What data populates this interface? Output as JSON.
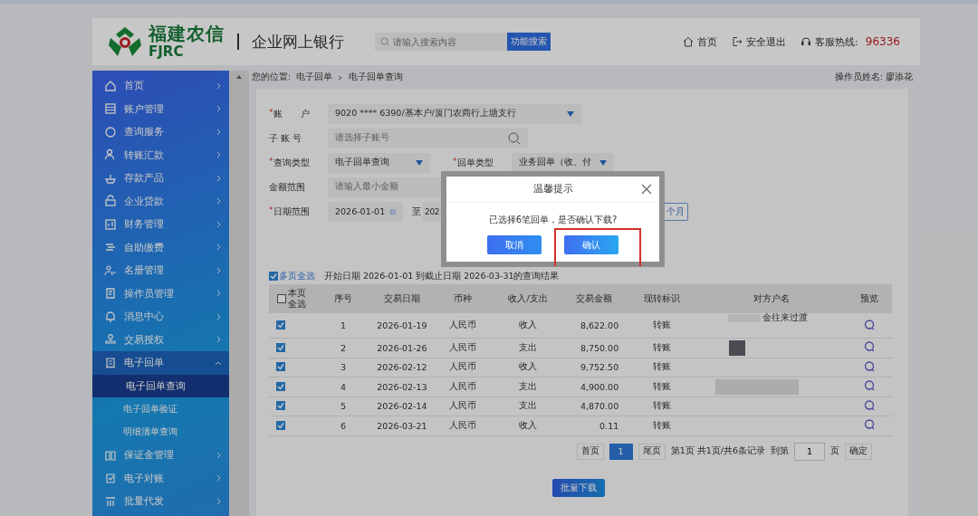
{
  "header": {
    "logo_cn": "福建农信",
    "logo_en": "FJRC",
    "site_title": "企业网上银行",
    "search": {
      "placeholder": "请输入搜索内容"
    },
    "search_button": "功能搜索",
    "links": [
      {
        "kind": "home",
        "label": "首页"
      },
      {
        "kind": "logout",
        "label": "安全退出"
      },
      {
        "kind": "hotline",
        "label": "客服热线:"
      }
    ],
    "hotline_number": "96336"
  },
  "sidebar": {
    "items": [
      {
        "label": "首页",
        "expanded": false
      },
      {
        "label": "账户管理",
        "expanded": false
      },
      {
        "label": "查询服务",
        "expanded": false
      },
      {
        "label": "转账汇款",
        "expanded": false
      },
      {
        "label": "存款产品",
        "expanded": false
      },
      {
        "label": "企业贷款",
        "expanded": false
      },
      {
        "label": "财务管理",
        "expanded": false
      },
      {
        "label": "自助缴费",
        "expanded": false
      },
      {
        "label": "名册管理",
        "expanded": false
      },
      {
        "label": "操作员管理",
        "expanded": false
      },
      {
        "label": "消息中心",
        "expanded": false
      },
      {
        "label": "交易授权",
        "expanded": false
      },
      {
        "label": "电子回单",
        "expanded": true,
        "children": [
          {
            "label": "电子回单查询",
            "selected": true
          },
          {
            "label": "电子回单验证",
            "selected": false
          },
          {
            "label": "明细清单查询",
            "selected": false
          }
        ]
      },
      {
        "label": "保证金管理",
        "expanded": false
      },
      {
        "label": "电子对账",
        "expanded": false
      },
      {
        "label": "批量代发",
        "expanded": false
      }
    ]
  },
  "breadcrumb": {
    "prefix": "您的位置:",
    "path": [
      "电子回单",
      "电子回单查询"
    ]
  },
  "operator": "操作员姓名: 廖添花",
  "form": {
    "rows": [
      {
        "fields": [
          {
            "kind": "select",
            "label": "账　　户",
            "marker": "*",
            "value": "9020 **** 6390/基本户/厦门农商行上塘支行"
          }
        ]
      },
      {
        "fields": [
          {
            "kind": "search",
            "label": "子 账 号",
            "placeholder": "请选择子账号"
          }
        ]
      },
      {
        "fields": [
          {
            "kind": "select",
            "label": "查询类型",
            "marker": "*",
            "value": "电子回单查询"
          },
          {
            "kind": "select",
            "label": "回单类型",
            "marker": "*",
            "value": "业务回单（收、付"
          }
        ]
      },
      {
        "fields": [
          {
            "kind": "text",
            "label": "金额范围",
            "placeholder": "请输入最小金额"
          }
        ]
      },
      {
        "fields": [
          {
            "kind": "daterange",
            "label": "日期范围",
            "marker": "*",
            "value": "2026-01-01",
            "separator": "至",
            "end_value": "202",
            "quick_button": "个月"
          }
        ]
      }
    ]
  },
  "results": {
    "select_all_pages": {
      "label": "多页全选",
      "checked": true
    },
    "summary": "开始日期 2026-01-01 到截止日期 2026-03-31的查询结果"
  },
  "table": {
    "select_page": {
      "label": "本页全选",
      "checked": false
    },
    "columns": [
      "序号",
      "交易日期",
      "币种",
      "收入/支出",
      "交易金额",
      "现转标识",
      "对方户名",
      "预览"
    ],
    "rows": [
      {
        "checked": true,
        "cells": [
          "1",
          "2026-01-19",
          "人民币",
          "收入",
          "8,622.00",
          "转账",
          "金往来过渡"
        ]
      },
      {
        "checked": true,
        "cells": [
          "2",
          "2026-01-26",
          "人民币",
          "支出",
          "8,750.00",
          "转账"
        ]
      },
      {
        "checked": true,
        "cells": [
          "3",
          "2026-02-12",
          "人民币",
          "收入",
          "9,752.50",
          "转账"
        ]
      },
      {
        "checked": true,
        "cells": [
          "4",
          "2026-02-13",
          "人民币",
          "支出",
          "4,900.00",
          "转账"
        ]
      },
      {
        "checked": true,
        "cells": [
          "5",
          "2026-02-14",
          "人民币",
          "支出",
          "4,870.00",
          "转账"
        ]
      },
      {
        "checked": true,
        "cells": [
          "6",
          "2026-03-21",
          "人民币",
          "收入",
          "0.11",
          "转账"
        ]
      }
    ]
  },
  "pager": {
    "first": "首页",
    "pages": [
      {
        "label": "1",
        "selected": true
      }
    ],
    "last": "尾页",
    "info": "第1页 共1页/共6条记录",
    "goto": "到第",
    "goto_value": "1",
    "unit": "页",
    "confirm": "确定"
  },
  "batch_button": "批量下载",
  "dialog": {
    "title": "温馨提示",
    "message": "已选择6笔回单，是否确认下载?",
    "buttons": [
      {
        "kind": "secondary",
        "label": "取消"
      },
      {
        "kind": "primary",
        "label": "确认"
      }
    ]
  }
}
